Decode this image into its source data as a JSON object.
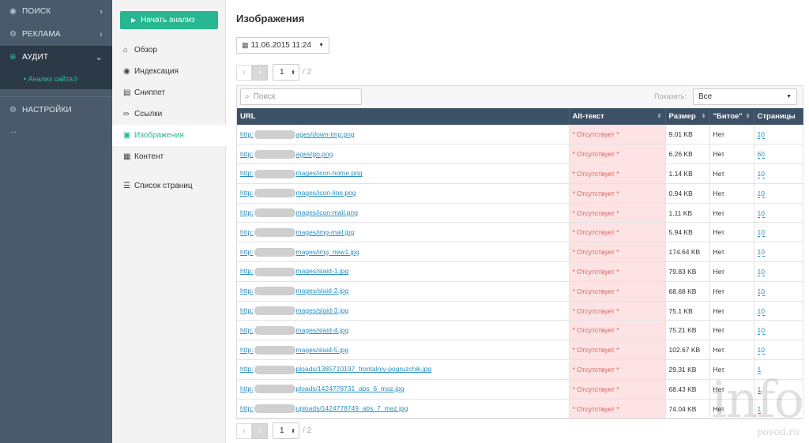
{
  "nav": {
    "items": [
      {
        "label": "ПОИСК",
        "icon": "eye-icon"
      },
      {
        "label": "РЕКЛАМА",
        "icon": "gear-icon"
      },
      {
        "label": "АУДИТ",
        "icon": "globe-icon"
      }
    ],
    "sub_item": "• Анализ сайта",
    "sub_sup": "β",
    "settings": "НАСТРОЙКИ",
    "collapse": "↔"
  },
  "submenu": {
    "start_button": "Начать анализ",
    "items": [
      {
        "label": "Обзор",
        "icon": "home-icon"
      },
      {
        "label": "Индексация",
        "icon": "eye-icon"
      },
      {
        "label": "Сниппет",
        "icon": "document-icon"
      },
      {
        "label": "Ссылки",
        "icon": "link-icon"
      },
      {
        "label": "Изображения",
        "icon": "image-icon"
      },
      {
        "label": "Контент",
        "icon": "file-icon"
      },
      {
        "label": "Список страниц",
        "icon": "list-icon"
      }
    ]
  },
  "main": {
    "title": "Изображения",
    "date": "11.06.2015 11:24",
    "pager": {
      "page": "1",
      "total": "/ 2"
    },
    "search_placeholder": "Поиск",
    "show_label": "Показать:",
    "show_value": "Все",
    "columns": [
      "URL",
      "Alt-текст",
      "Размер",
      "\"Битое\"",
      "Страницы"
    ],
    "rows": [
      {
        "url_pre": "http:",
        "url_post": "ages/down-img.png",
        "alt": "* Отсутствует *",
        "size": "9.01 KB",
        "broken": "Нет",
        "pages": "10"
      },
      {
        "url_pre": "http:",
        "url_post": "ages/go.png",
        "alt": "* Отсутствует *",
        "size": "6.26 KB",
        "broken": "Нет",
        "pages": "60"
      },
      {
        "url_pre": "http:",
        "url_post": "mages/icon-home.png",
        "alt": "* Отсутствует *",
        "size": "1.14 KB",
        "broken": "Нет",
        "pages": "10"
      },
      {
        "url_pre": "http:",
        "url_post": "mages/icon-line.png",
        "alt": "* Отсутствует *",
        "size": "0.94 KB",
        "broken": "Нет",
        "pages": "10"
      },
      {
        "url_pre": "http:",
        "url_post": "mages/icon-mail.png",
        "alt": "* Отсутствует *",
        "size": "1.11 KB",
        "broken": "Нет",
        "pages": "10"
      },
      {
        "url_pre": "http:",
        "url_post": "mages/img-mail.jpg",
        "alt": "* Отсутствует *",
        "size": "5.94 KB",
        "broken": "Нет",
        "pages": "10"
      },
      {
        "url_pre": "http:",
        "url_post": "mages/img_new1.jpg",
        "alt": "* Отсутствует *",
        "size": "174.64 KB",
        "broken": "Нет",
        "pages": "10"
      },
      {
        "url_pre": "http:",
        "url_post": "mages/slaid-1.jpg",
        "alt": "* Отсутствует *",
        "size": "79.83 KB",
        "broken": "Нет",
        "pages": "10"
      },
      {
        "url_pre": "http:",
        "url_post": "mages/slaid-2.jpg",
        "alt": "* Отсутствует *",
        "size": "68.68 KB",
        "broken": "Нет",
        "pages": "10"
      },
      {
        "url_pre": "http:",
        "url_post": "mages/slaid-3.jpg",
        "alt": "* Отсутствует *",
        "size": "75.1 KB",
        "broken": "Нет",
        "pages": "10"
      },
      {
        "url_pre": "http:",
        "url_post": "mages/slaid-4.jpg",
        "alt": "* Отсутствует *",
        "size": "75.21 KB",
        "broken": "Нет",
        "pages": "10"
      },
      {
        "url_pre": "http:",
        "url_post": "mages/slaid-5.jpg",
        "alt": "* Отсутствует *",
        "size": "102.67 KB",
        "broken": "Нет",
        "pages": "10"
      },
      {
        "url_pre": "http:",
        "url_post": "ploads/1385710197_frontalniy-pogruzchik.jpg",
        "alt": "* Отсутствует *",
        "size": "29.31 KB",
        "broken": "Нет",
        "pages": "1"
      },
      {
        "url_pre": "http:",
        "url_post": "ploads/1424778731_abs_6_maz.jpg",
        "alt": "* Отсутствует *",
        "size": "68.43 KB",
        "broken": "Нет",
        "pages": "1"
      },
      {
        "url_pre": "http:",
        "url_post": "uploads/1424778749_abs_7_maz.jpg",
        "alt": "* Отсутствует *",
        "size": "74.04 KB",
        "broken": "Нет",
        "pages": "1"
      }
    ]
  },
  "watermark": {
    "big": "info",
    "small": "povod.ru"
  }
}
